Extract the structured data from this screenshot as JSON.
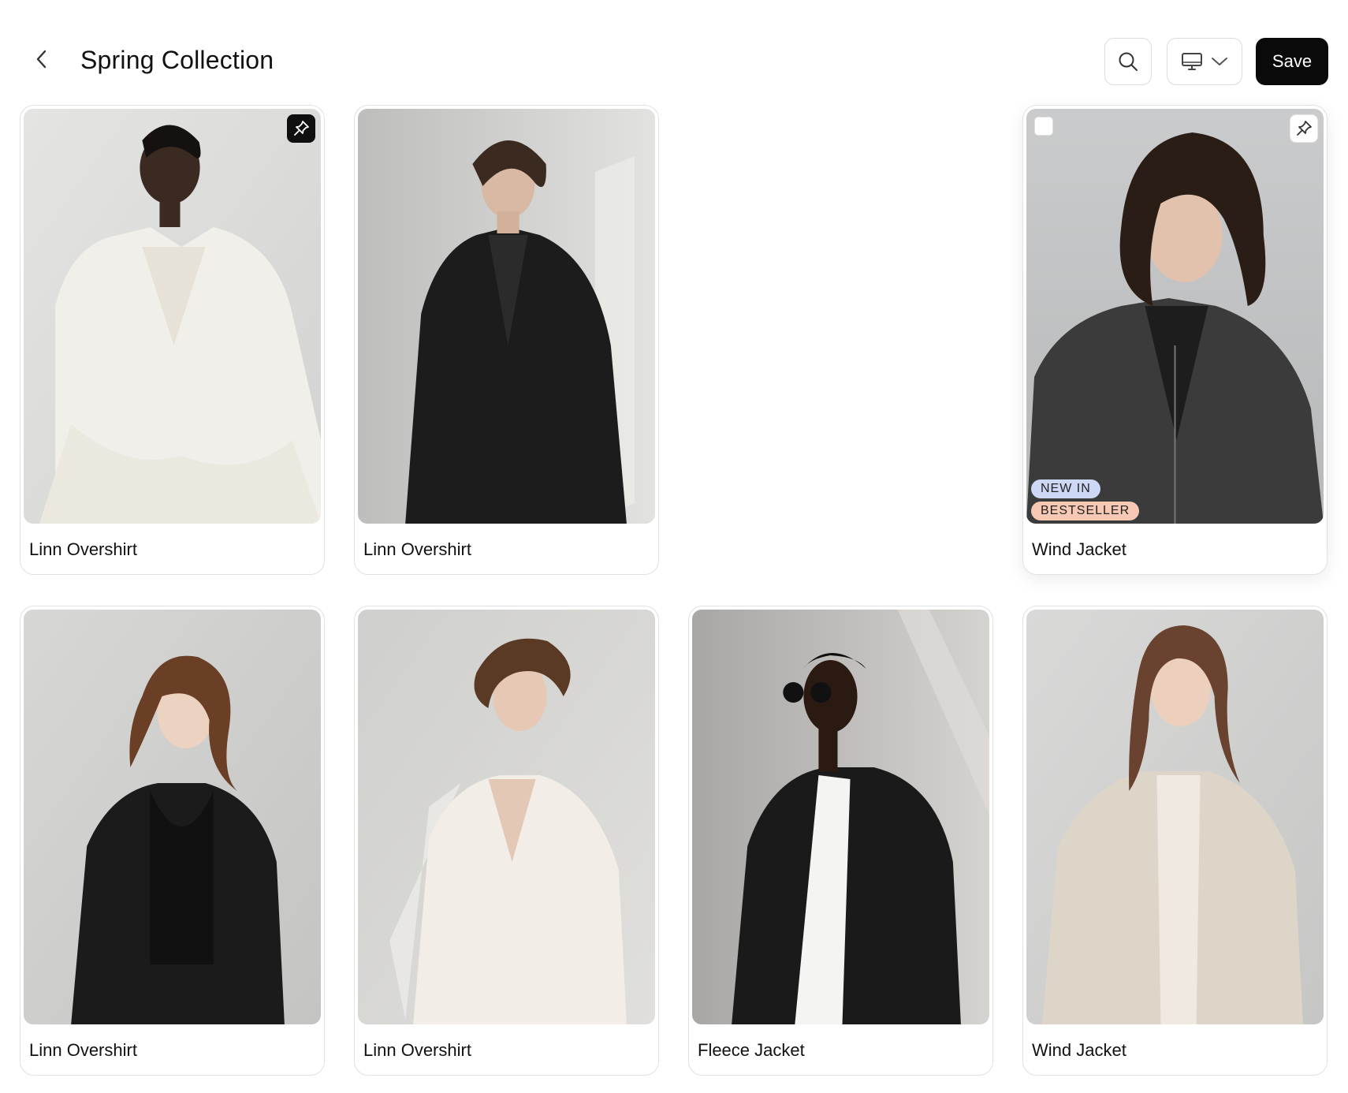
{
  "header": {
    "title": "Spring Collection",
    "save_label": "Save"
  },
  "icons": {
    "back": "chevron-left-icon",
    "search": "search-icon",
    "device": "monitor-icon",
    "dropdown": "chevron-down-icon",
    "pin": "pin-icon"
  },
  "colors": {
    "primary_button": "#0a0a0a",
    "badge_new": "#cdd8f5",
    "badge_bestseller": "#f7c9b4"
  },
  "products": [
    {
      "name": "Linn Overshirt",
      "pinned": true
    },
    {
      "name": "Linn Overshirt",
      "pinned": false
    },
    {
      "name": "Wind Jacket",
      "pinned": false,
      "badges": [
        "NEW IN",
        "BESTSELLER"
      ]
    },
    {
      "name": "Linn Overshirt",
      "pinned": false
    },
    {
      "name": "Linn Overshirt",
      "pinned": false
    },
    {
      "name": "Fleece Jacket",
      "pinned": false
    },
    {
      "name": "Wind Jacket",
      "pinned": false
    }
  ]
}
